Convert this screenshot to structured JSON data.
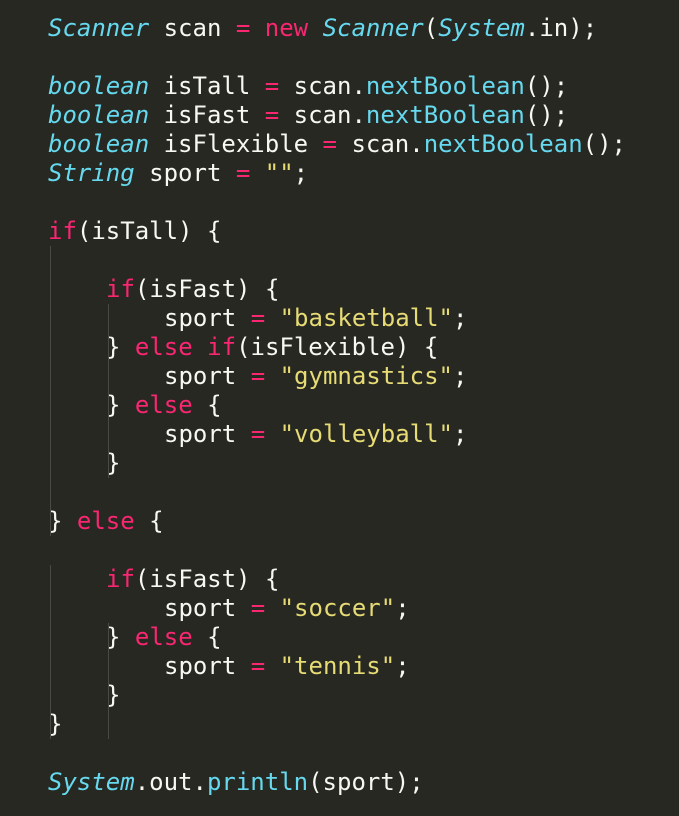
{
  "theme": {
    "background": "#272822",
    "foreground": "#f8f8f2",
    "keyword": "#f92672",
    "type": "#66d9ef",
    "function": "#66d9ef",
    "string": "#e6db74",
    "guide": "#4a4a42"
  },
  "code": {
    "lines": [
      {
        "indent": 0,
        "tokens": [
          {
            "t": "Scanner",
            "k": "type"
          },
          {
            "t": " scan ",
            "k": "plain"
          },
          {
            "t": "=",
            "k": "op"
          },
          {
            "t": " ",
            "k": "plain"
          },
          {
            "t": "new",
            "k": "kw"
          },
          {
            "t": " ",
            "k": "plain"
          },
          {
            "t": "Scanner",
            "k": "type"
          },
          {
            "t": "(",
            "k": "plain"
          },
          {
            "t": "System",
            "k": "type"
          },
          {
            "t": ".in);",
            "k": "plain"
          }
        ]
      },
      {
        "indent": 0,
        "tokens": []
      },
      {
        "indent": 0,
        "tokens": [
          {
            "t": "boolean",
            "k": "type"
          },
          {
            "t": " isTall ",
            "k": "plain"
          },
          {
            "t": "=",
            "k": "op"
          },
          {
            "t": " scan.",
            "k": "plain"
          },
          {
            "t": "nextBoolean",
            "k": "fn"
          },
          {
            "t": "();",
            "k": "plain"
          }
        ]
      },
      {
        "indent": 0,
        "tokens": [
          {
            "t": "boolean",
            "k": "type"
          },
          {
            "t": " isFast ",
            "k": "plain"
          },
          {
            "t": "=",
            "k": "op"
          },
          {
            "t": " scan.",
            "k": "plain"
          },
          {
            "t": "nextBoolean",
            "k": "fn"
          },
          {
            "t": "();",
            "k": "plain"
          }
        ]
      },
      {
        "indent": 0,
        "tokens": [
          {
            "t": "boolean",
            "k": "type"
          },
          {
            "t": " isFlexible ",
            "k": "plain"
          },
          {
            "t": "=",
            "k": "op"
          },
          {
            "t": " scan.",
            "k": "plain"
          },
          {
            "t": "nextBoolean",
            "k": "fn"
          },
          {
            "t": "();",
            "k": "plain"
          }
        ]
      },
      {
        "indent": 0,
        "tokens": [
          {
            "t": "String",
            "k": "type"
          },
          {
            "t": " sport ",
            "k": "plain"
          },
          {
            "t": "=",
            "k": "op"
          },
          {
            "t": " ",
            "k": "plain"
          },
          {
            "t": "\"\"",
            "k": "str"
          },
          {
            "t": ";",
            "k": "plain"
          }
        ]
      },
      {
        "indent": 0,
        "tokens": []
      },
      {
        "indent": 0,
        "tokens": [
          {
            "t": "if",
            "k": "kw"
          },
          {
            "t": "(isTall) {",
            "k": "plain"
          }
        ]
      },
      {
        "indent": 0,
        "tokens": []
      },
      {
        "indent": 1,
        "tokens": [
          {
            "t": "if",
            "k": "kw"
          },
          {
            "t": "(isFast) {",
            "k": "plain"
          }
        ]
      },
      {
        "indent": 2,
        "tokens": [
          {
            "t": "sport ",
            "k": "plain"
          },
          {
            "t": "=",
            "k": "op"
          },
          {
            "t": " ",
            "k": "plain"
          },
          {
            "t": "\"basketball\"",
            "k": "str"
          },
          {
            "t": ";",
            "k": "plain"
          }
        ]
      },
      {
        "indent": 1,
        "tokens": [
          {
            "t": "} ",
            "k": "plain"
          },
          {
            "t": "else",
            "k": "kw"
          },
          {
            "t": " ",
            "k": "plain"
          },
          {
            "t": "if",
            "k": "kw"
          },
          {
            "t": "(isFlexible) {",
            "k": "plain"
          }
        ]
      },
      {
        "indent": 2,
        "tokens": [
          {
            "t": "sport ",
            "k": "plain"
          },
          {
            "t": "=",
            "k": "op"
          },
          {
            "t": " ",
            "k": "plain"
          },
          {
            "t": "\"gymnastics\"",
            "k": "str"
          },
          {
            "t": ";",
            "k": "plain"
          }
        ]
      },
      {
        "indent": 1,
        "tokens": [
          {
            "t": "} ",
            "k": "plain"
          },
          {
            "t": "else",
            "k": "kw"
          },
          {
            "t": " {",
            "k": "plain"
          }
        ]
      },
      {
        "indent": 2,
        "tokens": [
          {
            "t": "sport ",
            "k": "plain"
          },
          {
            "t": "=",
            "k": "op"
          },
          {
            "t": " ",
            "k": "plain"
          },
          {
            "t": "\"volleyball\"",
            "k": "str"
          },
          {
            "t": ";",
            "k": "plain"
          }
        ]
      },
      {
        "indent": 1,
        "tokens": [
          {
            "t": "}",
            "k": "plain"
          }
        ]
      },
      {
        "indent": 0,
        "tokens": []
      },
      {
        "indent": 0,
        "tokens": [
          {
            "t": "} ",
            "k": "plain"
          },
          {
            "t": "else",
            "k": "kw"
          },
          {
            "t": " {",
            "k": "plain"
          }
        ]
      },
      {
        "indent": 0,
        "tokens": []
      },
      {
        "indent": 1,
        "tokens": [
          {
            "t": "if",
            "k": "kw"
          },
          {
            "t": "(isFast) {",
            "k": "plain"
          }
        ]
      },
      {
        "indent": 2,
        "tokens": [
          {
            "t": "sport ",
            "k": "plain"
          },
          {
            "t": "=",
            "k": "op"
          },
          {
            "t": " ",
            "k": "plain"
          },
          {
            "t": "\"soccer\"",
            "k": "str"
          },
          {
            "t": ";",
            "k": "plain"
          }
        ]
      },
      {
        "indent": 1,
        "tokens": [
          {
            "t": "} ",
            "k": "plain"
          },
          {
            "t": "else",
            "k": "kw"
          },
          {
            "t": " {",
            "k": "plain"
          }
        ]
      },
      {
        "indent": 2,
        "tokens": [
          {
            "t": "sport ",
            "k": "plain"
          },
          {
            "t": "=",
            "k": "op"
          },
          {
            "t": " ",
            "k": "plain"
          },
          {
            "t": "\"tennis\"",
            "k": "str"
          },
          {
            "t": ";",
            "k": "plain"
          }
        ]
      },
      {
        "indent": 1,
        "tokens": [
          {
            "t": "}",
            "k": "plain"
          }
        ]
      },
      {
        "indent": 0,
        "tokens": [
          {
            "t": "}",
            "k": "plain"
          }
        ]
      },
      {
        "indent": 0,
        "tokens": []
      },
      {
        "indent": 0,
        "tokens": [
          {
            "t": "System",
            "k": "type"
          },
          {
            "t": ".out.",
            "k": "plain"
          },
          {
            "t": "println",
            "k": "fn"
          },
          {
            "t": "(sport);",
            "k": "plain"
          }
        ]
      }
    ]
  }
}
